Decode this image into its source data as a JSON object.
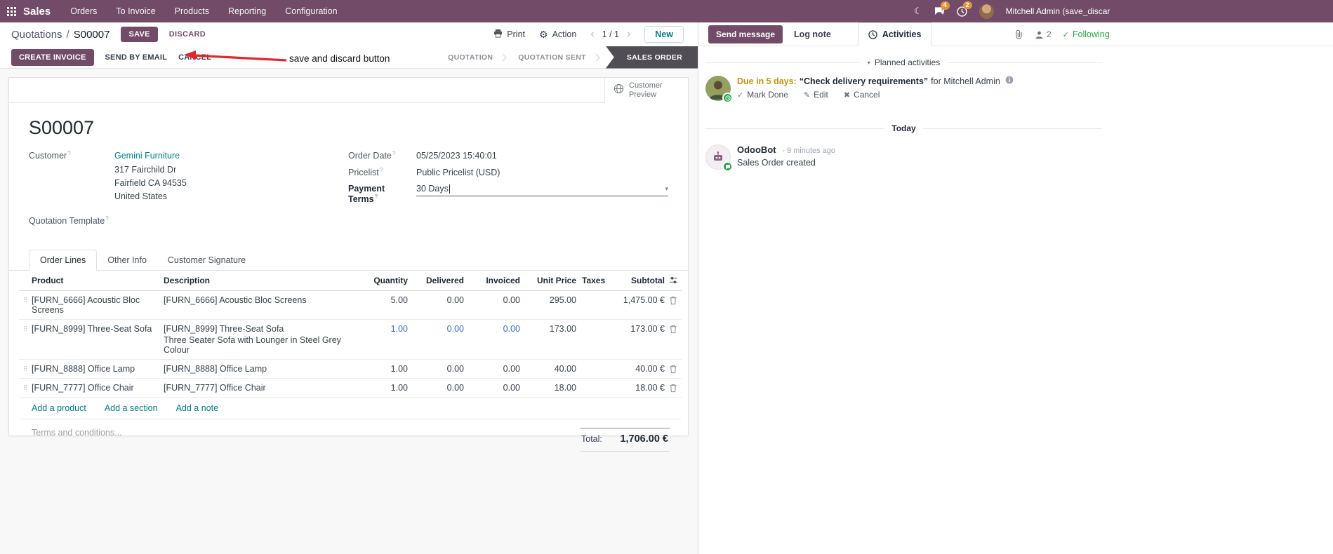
{
  "colors": {
    "navbar_bg": "#714B67",
    "primary": "#714B67",
    "link": "#017e84",
    "status_active_bg": "#504d55",
    "highlight_blue": "#2e6fd0",
    "due_warning": "#c7920b",
    "success_green": "#28a745",
    "annotation_red": "#e8242c",
    "badge_orange": "#e2953b"
  },
  "icons": {
    "moon": "☾",
    "gear": "⚙",
    "caret_down": "▾",
    "drag_handle": "⠿",
    "chevron_left": "‹",
    "chevron_right": "›",
    "check": "✓",
    "pencil": "✎",
    "x_mark": "✖",
    "help": "?"
  },
  "navbar": {
    "brand": "Sales",
    "menus": [
      "Orders",
      "To Invoice",
      "Products",
      "Reporting",
      "Configuration"
    ],
    "message_badge": "4",
    "activity_badge": "2",
    "user_name": "Mitchell Admin (save_discar"
  },
  "control_panel": {
    "breadcrumb_parent": "Quotations",
    "breadcrumb_separator": "/",
    "breadcrumb_current": "S00007",
    "save": "SAVE",
    "discard": "DISCARD",
    "print": "Print",
    "action": "Action",
    "pager": "1 / 1",
    "new": "New",
    "buttons": [
      "CREATE INVOICE",
      "SEND BY EMAIL",
      "CANCEL"
    ],
    "statusbar": [
      {
        "label": "QUOTATION",
        "active": false
      },
      {
        "label": "QUOTATION SENT",
        "active": false
      },
      {
        "label": "SALES ORDER",
        "active": true
      }
    ]
  },
  "annotation": {
    "label": "save and discard button"
  },
  "form": {
    "customer_preview": "Customer Preview",
    "title": "S00007",
    "customer_label": "Customer",
    "customer_name": "Gemini Furniture",
    "address_line1": "317 Fairchild Dr",
    "address_line2": "Fairfield CA 94535",
    "address_line3": "United States",
    "quotation_template_label": "Quotation Template",
    "order_date_label": "Order Date",
    "order_date": "05/25/2023 15:40:01",
    "pricelist_label": "Pricelist",
    "pricelist": "Public Pricelist (USD)",
    "payment_terms_label": "Payment Terms",
    "payment_terms": "30 Days",
    "tabs": [
      "Order Lines",
      "Other Info",
      "Customer Signature"
    ],
    "table": {
      "headers": [
        "Product",
        "Description",
        "Quantity",
        "Delivered",
        "Invoiced",
        "Unit Price",
        "Taxes",
        "Subtotal"
      ],
      "rows": [
        {
          "product": "[FURN_6666] Acoustic Bloc Screens",
          "description": "[FURN_6666] Acoustic Bloc Screens",
          "description2": "",
          "quantity": "5.00",
          "delivered": "0.00",
          "invoiced": "0.00",
          "unit_price": "295.00",
          "taxes": "",
          "subtotal": "1,475.00 €"
        },
        {
          "product": "[FURN_8999] Three-Seat Sofa",
          "description": "[FURN_8999] Three-Seat Sofa",
          "description2": "Three Seater Sofa with Lounger in Steel Grey Colour",
          "quantity": "1.00",
          "delivered": "0.00",
          "invoiced": "0.00",
          "unit_price": "173.00",
          "taxes": "",
          "subtotal": "173.00 €"
        },
        {
          "product": "[FURN_8888] Office Lamp",
          "description": "[FURN_8888] Office Lamp",
          "description2": "",
          "quantity": "1.00",
          "delivered": "0.00",
          "invoiced": "0.00",
          "unit_price": "40.00",
          "taxes": "",
          "subtotal": "40.00 €"
        },
        {
          "product": "[FURN_7777] Office Chair",
          "description": "[FURN_7777] Office Chair",
          "description2": "",
          "quantity": "1.00",
          "delivered": "0.00",
          "invoiced": "0.00",
          "unit_price": "18.00",
          "taxes": "",
          "subtotal": "18.00 €"
        }
      ],
      "add_links": [
        "Add a product",
        "Add a section",
        "Add a note"
      ]
    },
    "terms_placeholder": "Terms and conditions...",
    "total_label": "Total:",
    "total_value": "1,706.00 €"
  },
  "chatter": {
    "send_message": "Send message",
    "log_note": "Log note",
    "activities_tab": "Activities",
    "followers_count": "2",
    "following": "Following",
    "planned_activities_header": "Planned activities",
    "activity": {
      "due": "Due in 5 days:",
      "summary": "“Check delivery requirements”",
      "assignee": "for Mitchell Admin",
      "mark_done": "Mark Done",
      "edit": "Edit",
      "cancel": "Cancel"
    },
    "today": "Today",
    "message": {
      "author": "OdooBot",
      "time": "- 9 minutes ago",
      "body": "Sales Order created"
    }
  }
}
